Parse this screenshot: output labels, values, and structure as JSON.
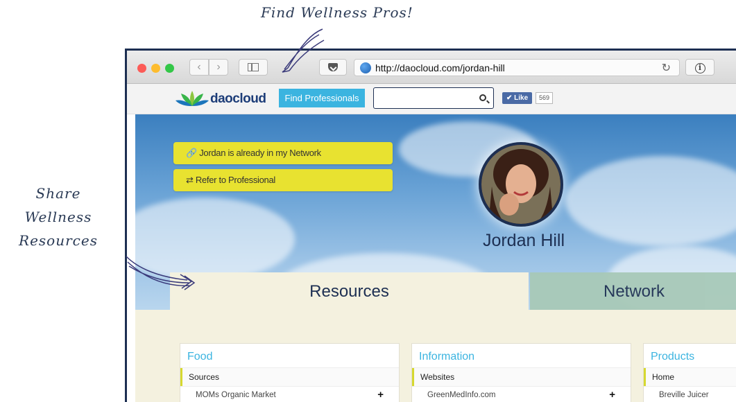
{
  "annotations": {
    "top": "Find Wellness Pros!",
    "left_line1": "Share Wellness",
    "left_line2": "Resources"
  },
  "browser": {
    "url": "http://daocloud.com/jordan-hill"
  },
  "site": {
    "logo_text": "daocloud",
    "find_button": "Find Professionals",
    "search_placeholder": "",
    "like_label": "✔ Like",
    "like_count": "569"
  },
  "profile": {
    "network_button": "🔗 Jordan is already in my Network",
    "refer_button": "⇄ Refer to Professional",
    "name": "Jordan Hill"
  },
  "tabs": {
    "resources": "Resources",
    "network": "Network"
  },
  "cards": [
    {
      "title": "Food",
      "category": "Sources",
      "item": "MOMs Organic Market",
      "has_add": true
    },
    {
      "title": "Information",
      "category": "Websites",
      "item": "GreenMedInfo.com",
      "has_add": true
    },
    {
      "title": "Products",
      "category": "Home",
      "item": "Breville Juicer",
      "has_add": false
    }
  ],
  "colors": {
    "accent": "#3bb4e0",
    "brand_navy": "#1d2f52",
    "button_yellow": "#e8e230",
    "content_bg": "#f4f1df"
  }
}
